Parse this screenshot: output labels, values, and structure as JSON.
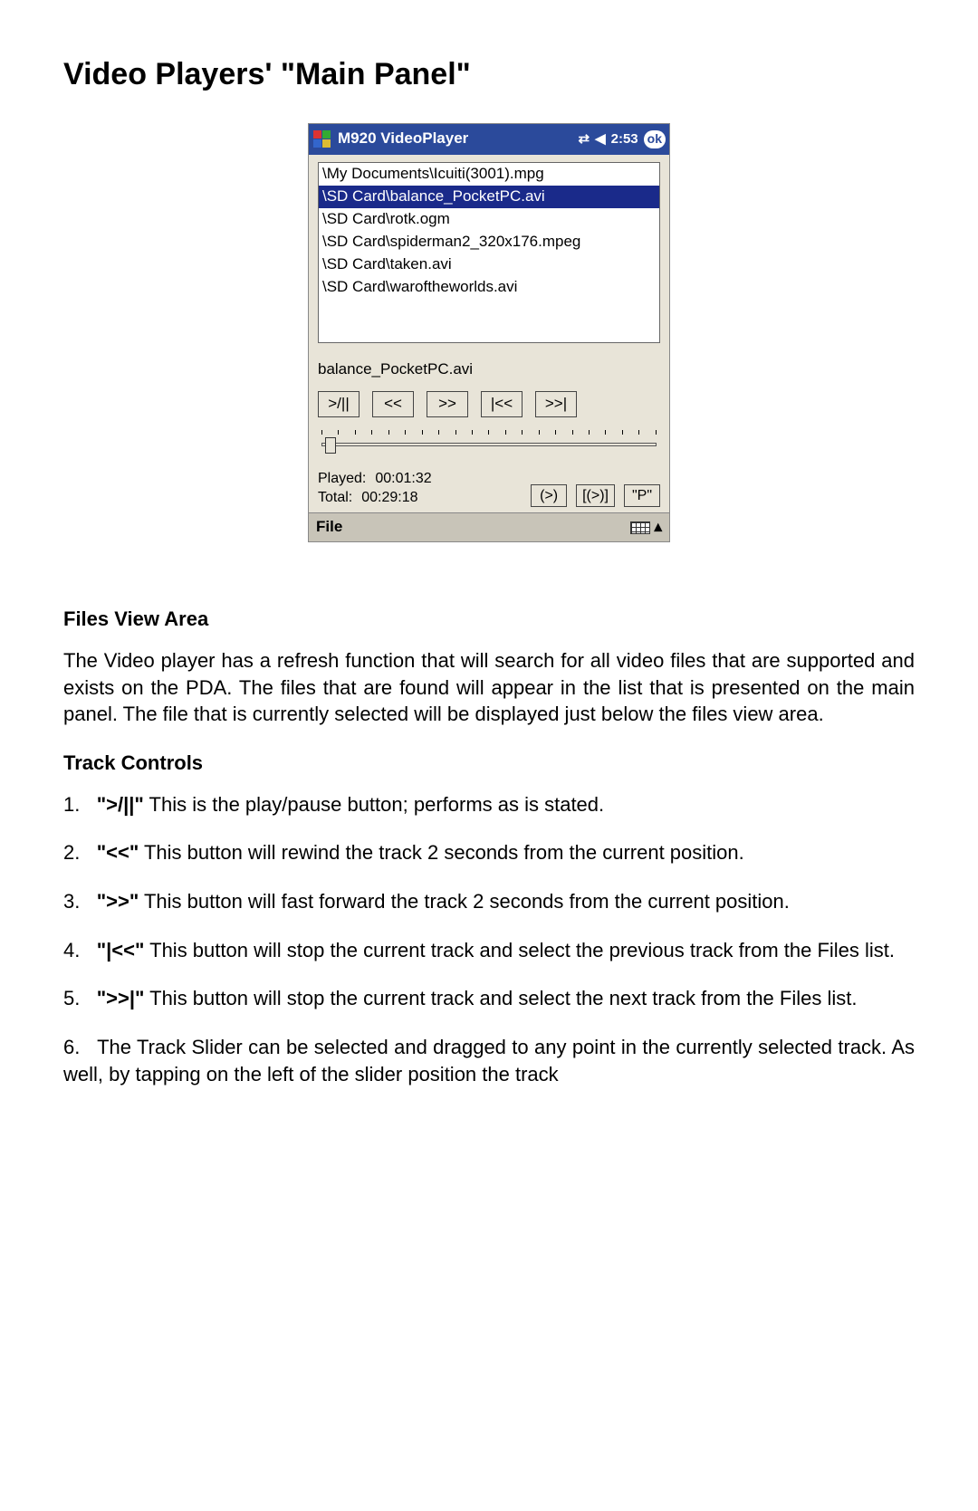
{
  "page": {
    "title": "Video Players' \"Main Panel\"",
    "sections": {
      "files_view": {
        "heading": "Files View Area",
        "body": "The Video player has a refresh function that will search for all video files that are supported and exists on the PDA.  The files that are found will appear in the list that is presented on the main panel.  The file that is currently selected will be displayed just below the files view area."
      },
      "track_controls": {
        "heading": "Track Controls",
        "items": [
          {
            "num": "1.",
            "sym": "\">/||\"",
            "text": " This is the play/pause button; performs as is stated."
          },
          {
            "num": "2.",
            "sym": "\"<<\"",
            "text": " This button will rewind the track 2 seconds from the current position."
          },
          {
            "num": "3.",
            "sym": "\">>\"",
            "text": " This button will fast forward the track 2 seconds from the current position."
          },
          {
            "num": "4.",
            "sym": "\"|<<\"",
            "text": " This button will stop the current track and select the previous track from the Files list."
          },
          {
            "num": "5.",
            "sym": "\">>|\"",
            "text": " This button will stop the current track and select the next track from the Files list."
          },
          {
            "num": "6.",
            "sym": "",
            "text": "The Track Slider can be selected and dragged to any point in the currently selected track. As well, by tapping on the left of the slider position the track"
          }
        ]
      }
    }
  },
  "pda": {
    "title": "M920 VideoPlayer",
    "time": "2:53",
    "ok": "ok",
    "files": [
      {
        "path": "\\My Documents\\Icuiti(3001).mpg",
        "selected": false
      },
      {
        "path": "\\SD Card\\balance_PocketPC.avi",
        "selected": true
      },
      {
        "path": "\\SD Card\\rotk.ogm",
        "selected": false
      },
      {
        "path": "\\SD Card\\spiderman2_320x176.mpeg",
        "selected": false
      },
      {
        "path": "\\SD Card\\taken.avi",
        "selected": false
      },
      {
        "path": "\\SD Card\\waroftheworlds.avi",
        "selected": false
      }
    ],
    "current_file": "balance_PocketPC.avi",
    "buttons": {
      "playpause": ">/||",
      "rewind": "<<",
      "forward": ">>",
      "prev": "|<<",
      "next": ">>|"
    },
    "time_info": {
      "played_label": "Played:",
      "played_value": "00:01:32",
      "total_label": "Total:",
      "total_value": "00:29:18"
    },
    "side_buttons": {
      "b1": "(>)",
      "b2": "[(>)]",
      "b3": "\"P\""
    },
    "bottombar": {
      "file": "File",
      "up": "▴"
    }
  }
}
